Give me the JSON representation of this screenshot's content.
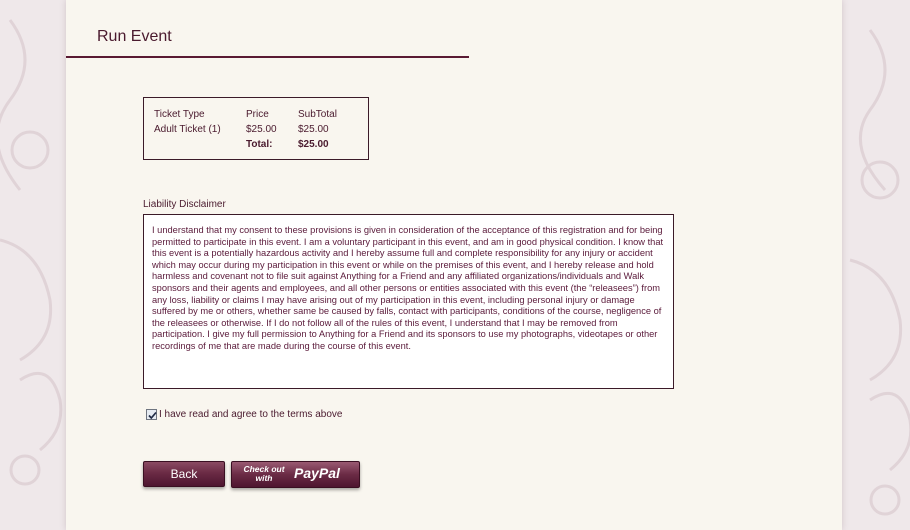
{
  "page": {
    "title": "Run Event"
  },
  "ticket_table": {
    "headers": [
      "Ticket Type",
      "Price",
      "SubTotal"
    ],
    "rows": [
      {
        "type": "Adult Ticket (1)",
        "price": "$25.00",
        "subtotal": "$25.00"
      }
    ],
    "total_label": "Total:",
    "total_value": "$25.00"
  },
  "disclaimer": {
    "label": "Liability Disclaimer",
    "text": "I understand that my consent to these provisions is given in consideration of the acceptance of this registration and for being permitted to participate in this event. I am a voluntary participant in this event, and am in good physical condition. I know that this event is a potentially hazardous activity and I hereby assume full and complete responsibility for any injury or accident which may occur during my participation in this event or while on the premises of this event, and I hereby release and hold harmless and covenant not to file suit against Anything for a Friend and any affiliated organizations/individuals and Walk sponsors and their agents and employees, and all other persons or entities associated with this event (the “releasees”) from any loss, liability or claims I may have arising out of my participation in this event, including personal injury or damage suffered by me or others, whether same be caused by falls, contact with participants, conditions of the course, negligence of the releasees or otherwise. If I do not follow all of the rules of this event, I understand that I may be removed from participation. I give my full permission to Anything for a Friend and its sponsors to use my photographs, videotapes or other recordings of me that are made during the course of this event."
  },
  "agree": {
    "label": "I have read and agree to the terms above",
    "checked": true
  },
  "buttons": {
    "back_label": "Back",
    "paypal_small": "Check out with",
    "paypal_big": "PayPal"
  },
  "colors": {
    "accent": "#5a1a33",
    "panel": "#f9f6ef",
    "text": "#4a1a2e",
    "button": "#6b2b45"
  }
}
